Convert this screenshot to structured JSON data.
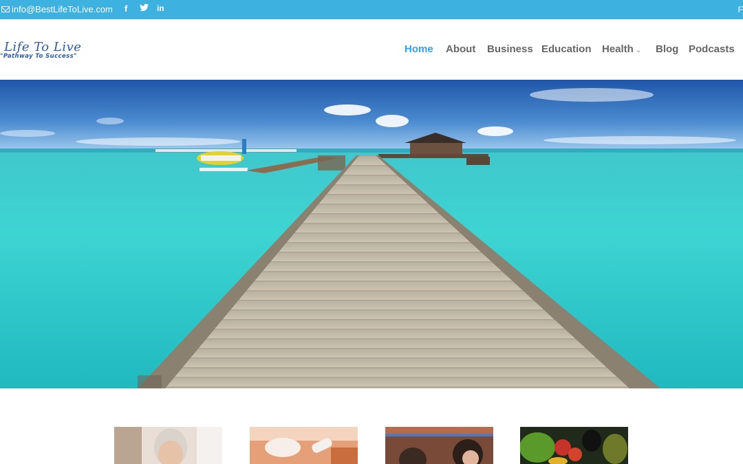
{
  "topbar": {
    "email": "info@BestLifeToLive.com",
    "social": [
      "facebook-icon",
      "twitter-icon",
      "linkedin-icon"
    ],
    "right_partial": "F",
    "bg_color": "#3db1e0"
  },
  "logo": {
    "name": "Best Life To Live",
    "visible_name": "t Life To Live",
    "tagline": "\"Pathway To Success\""
  },
  "nav": {
    "items": [
      {
        "label": "Home",
        "active": true
      },
      {
        "label": "About"
      },
      {
        "label": "Business"
      },
      {
        "label": "Education"
      },
      {
        "label": "Health",
        "has_dropdown": true
      },
      {
        "label": "Blog"
      },
      {
        "label": "Podcasts"
      }
    ],
    "active_color": "#2ea3f2",
    "text_color": "#666666"
  },
  "hero": {
    "image": "tropical lagoon with wooden pier, seaplane and overwater bungalow"
  },
  "thumbnails": [
    {
      "image": "smiling older woman"
    },
    {
      "image": "pills and capsules"
    },
    {
      "image": "students in library"
    },
    {
      "image": "fresh vegetables and fruit"
    }
  ]
}
